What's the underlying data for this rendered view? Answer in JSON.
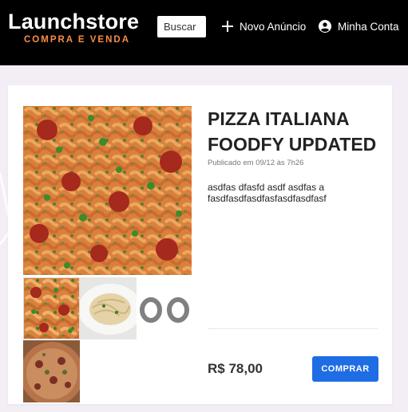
{
  "header": {
    "logo": "Launchstore",
    "tagline": "COMPRA E VENDA",
    "search_placeholder": "Buscar",
    "new_listing_label": "Novo Anúncio",
    "account_label": "Minha Conta"
  },
  "product": {
    "title": "PIZZA ITALIANA FOODFY UPDATED",
    "published": "Publicado em 09/12 às 7h26",
    "description": "asdfas dfasfd asdf asdfas a fasdfasdfasdfasfasdfasdfasf",
    "price": "R$ 78,00",
    "buy_label": "COMPRAR"
  },
  "photos": [
    "pasta-bake-photo",
    "spaghetti-plate-photo",
    "blurred-text-photo",
    "pizza-photo"
  ],
  "colors": {
    "header_bg": "#000000",
    "tagline": "#fb8c44",
    "page_bg": "#f3eef6",
    "buy_button": "#1f6de4"
  }
}
